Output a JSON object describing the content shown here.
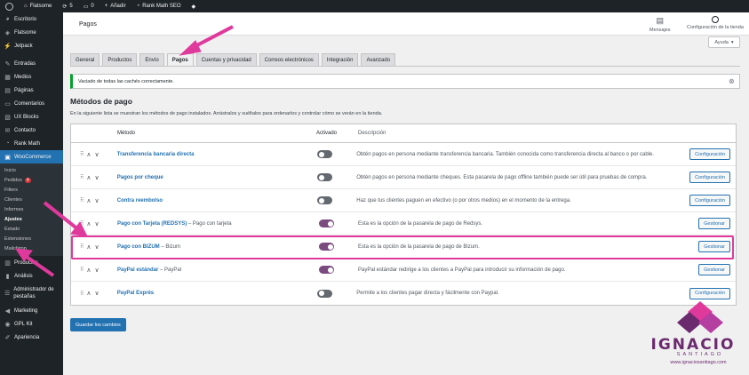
{
  "admin_bar": {
    "site": "Flatsome",
    "updates": "5",
    "comments": "0",
    "new": "Añadir",
    "seo": "Rank Math SEO"
  },
  "sidebar": {
    "top_items": [
      {
        "label": "Escritorio",
        "icon": "dashboard-icon"
      },
      {
        "label": "Flatsome",
        "icon": "flatsome-icon"
      },
      {
        "label": "Jetpack",
        "icon": "jetpack-icon"
      }
    ],
    "content_items": [
      {
        "label": "Entradas",
        "icon": "pin-icon"
      },
      {
        "label": "Medios",
        "icon": "media-icon"
      },
      {
        "label": "Páginas",
        "icon": "pages-icon"
      },
      {
        "label": "Comentarios",
        "icon": "comments-icon"
      },
      {
        "label": "UX Blocks",
        "icon": "blocks-icon"
      },
      {
        "label": "Contacto",
        "icon": "mail-icon"
      },
      {
        "label": "Rank Math",
        "icon": "chart-icon"
      }
    ],
    "woocommerce": {
      "label": "WooCommerce",
      "icon": "woo-icon"
    },
    "woo_sub": [
      {
        "label": "Inicio"
      },
      {
        "label": "Pedidos",
        "badge": "4"
      },
      {
        "label": "Filters"
      },
      {
        "label": "Clientes"
      },
      {
        "label": "Informes"
      },
      {
        "label": "Ajustes",
        "current": true
      },
      {
        "label": "Estado"
      },
      {
        "label": "Extensiones"
      },
      {
        "label": "Mailchimp"
      }
    ],
    "bottom_items": [
      {
        "label": "Productos",
        "icon": "products-icon"
      },
      {
        "label": "Análisis",
        "icon": "analytics-icon"
      },
      {
        "label": "Administrador de pestañas",
        "icon": "tabs-icon"
      },
      {
        "label": "Marketing",
        "icon": "megaphone-icon"
      },
      {
        "label": "GPL Kit",
        "icon": "gpl-icon"
      },
      {
        "label": "Apariencia",
        "icon": "brush-icon"
      }
    ]
  },
  "header": {
    "title": "Pagos",
    "messages": "Mensajes",
    "store_config": "Configuración de la tienda",
    "help": "Ayuda"
  },
  "tabs": [
    "General",
    "Productos",
    "Envío",
    "Pagos",
    "Cuentas y privacidad",
    "Correos electrónicos",
    "Integración",
    "Avanzado"
  ],
  "active_tab": "Pagos",
  "notice": "Vaciado de todas las cachés correctamente.",
  "section": {
    "title": "Métodos de pago",
    "description": "En la siguiente lista se muestran los métodos de pago instalados. Arrástralos y suéltalos para ordenarlos y controlar cómo se verán en la tienda."
  },
  "table": {
    "headers": {
      "method": "Método",
      "enabled": "Activado",
      "description": "Descripción"
    },
    "rows": [
      {
        "name": "Transferencia bancaria directa",
        "suffix": "",
        "enabled": false,
        "description": "Obtén pagos en persona mediante transferencia bancaria. También conocida como transferencia directa al banco o por cable.",
        "action": "Configuración"
      },
      {
        "name": "Pagos por cheque",
        "suffix": "",
        "enabled": false,
        "description": "Obtén pagos en persona mediante cheques. Esta pasarela de pago offline también puede ser útil para pruebas de compra.",
        "action": "Configuración"
      },
      {
        "name": "Contra reembolso",
        "suffix": "",
        "enabled": false,
        "description": "Haz que tus clientes paguen en efectivo (o por otros medios) en el momento de la entrega.",
        "action": "Configuración"
      },
      {
        "name": "Pago con Tarjeta (REDSYS)",
        "suffix": " – Pago con tarjeta",
        "enabled": true,
        "description": "Esta es la opción de la pasarela de pago de Redsys.",
        "action": "Gestionar"
      },
      {
        "name": "Pago con BIZUM",
        "suffix": " – Bizum",
        "enabled": true,
        "description": "Esta es la opción de la pasarela de pago de Bizum.",
        "action": "Gestionar"
      },
      {
        "name": "PayPal estándar",
        "suffix": " – PayPal",
        "enabled": true,
        "description": "PayPal estándar redirige a los clientes a PayPal para introducir su información de pago.",
        "action": "Gestionar"
      },
      {
        "name": "PayPal Exprés",
        "suffix": "",
        "enabled": false,
        "description": "Permite a los clientes pagar directa y fácilmente con Paypal.",
        "action": "Configuración"
      }
    ]
  },
  "save_button": "Guardar los cambios",
  "brand": {
    "name": "IGNACIO",
    "sub": "SANTIAGO",
    "url": "www.ignaciosantiago.com"
  },
  "colors": {
    "accent": "#2271b1",
    "toggle_on": "#7b4b7f",
    "highlight": "#e0399c",
    "sidebar": "#1d2327"
  }
}
